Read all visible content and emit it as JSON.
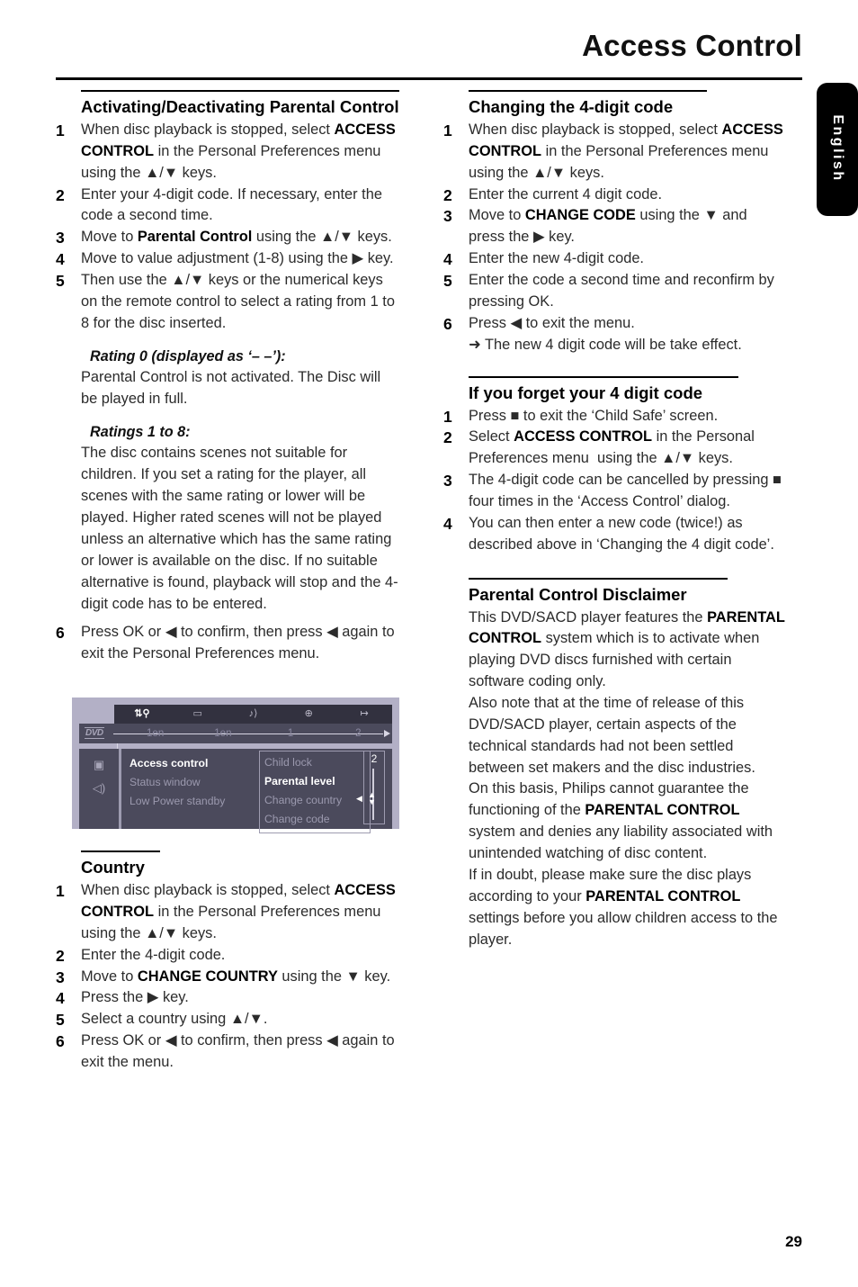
{
  "header": {
    "title": "Access Control",
    "language_tab": "English"
  },
  "page_number": "29",
  "left_column": {
    "section1": {
      "heading": "Activating/Deactivating Parental Control",
      "steps": [
        {
          "num": "1",
          "text": "When disc playback is stopped, select ACCESS CONTROL in the Personal Preferences menu using the ▲/▼ keys."
        },
        {
          "num": "2",
          "text": "Enter your 4-digit code. If necessary, enter the code a second time."
        },
        {
          "num": "3",
          "text": "Move to Parental Control using the ▲/▼ keys."
        },
        {
          "num": "4",
          "text": "Move to value adjustment (1-8) using the ▶ key."
        },
        {
          "num": "5",
          "text": "Then use the ▲/▼ keys or the numerical keys on the remote control to select a rating from 1 to 8 for the disc inserted."
        }
      ],
      "rating0_heading": "Rating 0 (displayed as ‘– –’):",
      "rating0_body": "Parental Control is not activated. The Disc will be played in full.",
      "ratings18_heading": "Ratings 1 to 8:",
      "ratings18_body": "The disc contains scenes not suitable for children. If you set a rating for the player, all scenes with the same rating or lower will be played. Higher rated scenes will not be played unless an alternative which has the same rating or lower is available on the disc. If no suitable alternative is found, playback will stop and the 4-digit code has to be entered.",
      "step6": {
        "num": "6",
        "text": "Press OK or ◀ to confirm, then press ◀ again to exit the Personal Preferences menu."
      }
    },
    "figure": {
      "top_icons": [
        "tools-icon",
        "subtitle-icon",
        "audio-icon",
        "globe-icon",
        "exit-icon"
      ],
      "top_icon_glyphs": [
        "↑↓",
        "▢",
        "♪",
        "⊕",
        "↦"
      ],
      "top_values": [
        "1en",
        "1en",
        "1",
        "2"
      ],
      "disc_label": "DVD",
      "side_icons": [
        "picture-icon",
        "sound-icon"
      ],
      "menu_items": [
        "Access control",
        "Status window",
        "Low Power standby"
      ],
      "menu_selected_index": 0,
      "submenu_items": [
        "Child lock",
        "Parental level",
        "Change country",
        "Change code"
      ],
      "submenu_selected_index": 1,
      "value": "2"
    },
    "section2": {
      "heading": "Country",
      "steps": [
        {
          "num": "1",
          "text": "When disc playback is stopped, select ACCESS CONTROL in the Personal Preferences menu using the ▲/▼ keys."
        },
        {
          "num": "2",
          "text": "Enter the 4-digit code."
        },
        {
          "num": "3",
          "text": "Move to CHANGE COUNTRY using the ▼ key."
        },
        {
          "num": "4",
          "text": "Press the ▶ key."
        },
        {
          "num": "5",
          "text": "Select a country using ▲/▼."
        },
        {
          "num": "6",
          "text": "Press OK or ◀ to confirm, then press ◀ again to exit the menu."
        }
      ]
    }
  },
  "right_column": {
    "section1": {
      "heading": "Changing the 4-digit code",
      "steps": [
        {
          "num": "1",
          "text": "When disc playback is stopped, select ACCESS CONTROL in the Personal Preferences menu using the ▲/▼ keys."
        },
        {
          "num": "2",
          "text": "Enter the current 4 digit code."
        },
        {
          "num": "3",
          "text": "Move to CHANGE CODE using the ▼ and press the ▶ key."
        },
        {
          "num": "4",
          "text": "Enter the new 4-digit code."
        },
        {
          "num": "5",
          "text": "Enter the code a second time and reconfirm by pressing OK."
        },
        {
          "num": "6",
          "text": "Press ◀ to exit the menu."
        }
      ],
      "note": "➜ The new 4 digit code will be take effect."
    },
    "section2": {
      "heading": "If you forget your 4 digit code",
      "steps": [
        {
          "num": "1",
          "text": "Press ■ to exit the ‘Child Safe’ screen."
        },
        {
          "num": "2",
          "text": "Select ACCESS CONTROL in the Personal Preferences menu  using the ▲/▼ keys."
        },
        {
          "num": "3",
          "text": "The 4-digit code can be cancelled by pressing ■ four times in the ‘Access Control’ dialog."
        },
        {
          "num": "4",
          "text": "You can then enter a new code (twice!) as described above in ‘Changing the 4 digit code’."
        }
      ]
    },
    "section3": {
      "heading": "Parental Control Disclaimer",
      "paragraph1": "This DVD/SACD player features the PARENTAL CONTROL system which is to activate when playing DVD discs furnished with certain software coding only.",
      "paragraph2": "Also note that at the time of release of this DVD/SACD player, certain aspects of the technical standards had not been settled between set makers and the disc industries.",
      "paragraph3": "On this basis, Philips cannot guarantee the functioning of the PARENTAL CONTROL system and denies any liability associated with unintended watching of disc content.",
      "paragraph4": "If in doubt, please make sure the disc plays according to your PARENTAL CONTROL settings before you allow children access to the player."
    }
  },
  "colors": {
    "page_background": "#ffffff",
    "text": "#2b2b2b",
    "heading": "#000000",
    "tab_background": "#000000",
    "tab_text": "#ffffff",
    "figure_border": "#b3b0c6",
    "figure_panel": "#4b4a5c",
    "figure_topbar": "#32313f",
    "figure_dim_text": "#9b99ae",
    "figure_bright_text": "#ffffff"
  }
}
